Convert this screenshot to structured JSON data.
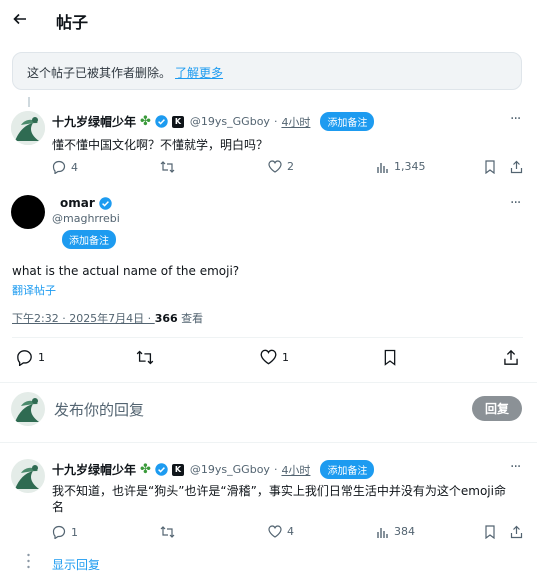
{
  "header": {
    "title": "帖子"
  },
  "deleted_notice": {
    "text": "这个帖子已被其作者删除。",
    "link": "了解更多"
  },
  "post1": {
    "author": "十九岁绿帽少年",
    "handle": "@19ys_GGboy",
    "time": "4小时",
    "add_note": "添加备注",
    "text": "懂不懂中国文化啊？不懂就学，明白吗？",
    "replies": "4",
    "likes": "2",
    "views": "1,345",
    "k_badge": "K"
  },
  "main_post": {
    "name": "omar",
    "handle": "@maghrrebi",
    "add_note": "添加备注",
    "text": "what is the actual name of the emoji?",
    "translate": "翻译帖子",
    "meta_time": "下午2:32 · 2025年7月4日 · ",
    "views_count": "366",
    "views_label": " 查看",
    "replies": "1",
    "likes": "1"
  },
  "reply_box": {
    "placeholder": "发布你的回复",
    "button": "回复"
  },
  "post2": {
    "author": "十九岁绿帽少年",
    "handle": "@19ys_GGboy",
    "time": "4小时",
    "add_note": "添加备注",
    "text": "我不知道，也许是“狗头”也许是“滑稽”，事实上我们日常生活中并没有为这个emoji命名",
    "replies": "1",
    "likes": "4",
    "views": "384",
    "k_badge": "K"
  },
  "show_replies": "显示回复",
  "more_label": "···",
  "colors": {
    "accent": "#1d9bf0",
    "text": "#0f1419",
    "muted": "#536471"
  }
}
